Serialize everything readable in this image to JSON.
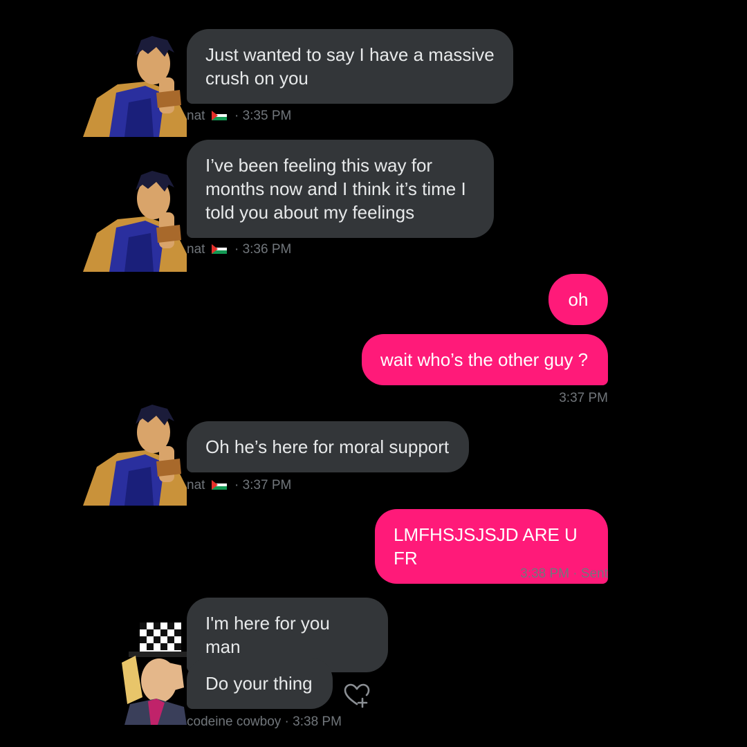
{
  "conversation": {
    "messages": [
      {
        "text": "Just wanted to say I have a massive crush on you"
      },
      {
        "text": "I’ve been feeling this way for months now and I think it’s time I told you about my feelings"
      },
      {
        "text": "oh"
      },
      {
        "text": "wait who’s the other guy ?"
      },
      {
        "text": "Oh he’s here for moral support"
      },
      {
        "text": "LMFHSJSJSJD ARE U FR"
      },
      {
        "text": "I'm here for you man"
      },
      {
        "text": "Do your thing"
      }
    ],
    "meta": {
      "m1_name": "nat",
      "m1_time": "· 3:35 PM",
      "m2_name": "nat",
      "m2_time": "· 3:36 PM",
      "m4_time": "3:37 PM",
      "m5_name": "nat",
      "m5_time": "· 3:37 PM",
      "m6_time": "3:38 PM · Sent",
      "m8_name": "codeine cowboy",
      "m8_time": "· 3:38 PM"
    }
  },
  "icons": {
    "flag": "palestine-flag-icon",
    "reaction": "heart-plus-icon"
  },
  "colors": {
    "background": "#000000",
    "incoming_bubble": "#333639",
    "outgoing_bubble": "#ff1a79",
    "meta_text": "#71767b"
  }
}
